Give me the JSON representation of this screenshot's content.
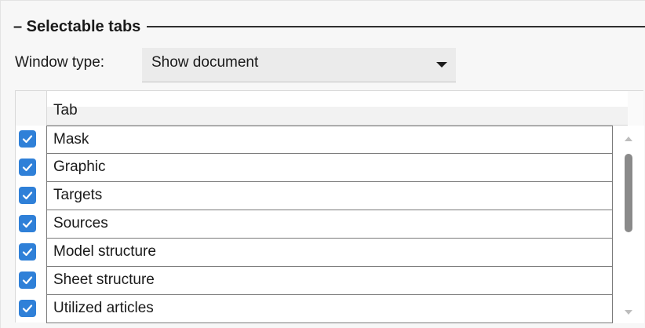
{
  "group": {
    "title": "– Selectable tabs"
  },
  "window_type": {
    "label": "Window type:",
    "value": "Show document"
  },
  "grid": {
    "column_header": "Tab",
    "rows": [
      {
        "label": "Mask",
        "checked": true
      },
      {
        "label": "Graphic",
        "checked": true
      },
      {
        "label": "Targets",
        "checked": true
      },
      {
        "label": "Sources",
        "checked": true
      },
      {
        "label": "Model structure",
        "checked": true
      },
      {
        "label": "Sheet structure",
        "checked": true
      },
      {
        "label": "Utilized articles",
        "checked": true
      }
    ]
  },
  "colors": {
    "checkbox": "#2f80d8",
    "dropdown_bg": "#ebebeb",
    "panel_bg": "#f7f7f7"
  },
  "icons": {
    "dropdown": "chevron-down-icon",
    "check": "checkmark-icon",
    "scroll_up": "scroll-up-arrow-icon",
    "scroll_down": "scroll-down-arrow-icon"
  }
}
